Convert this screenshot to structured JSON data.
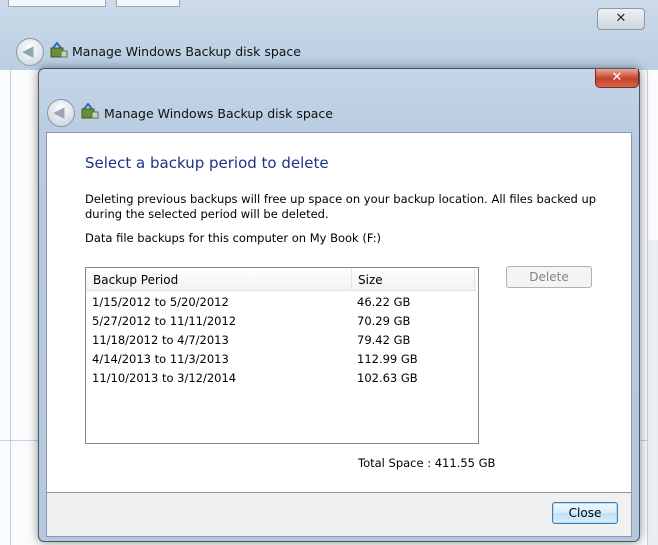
{
  "background": {
    "window_title": "Manage Windows Backup disk space",
    "close_glyph": "✕"
  },
  "dialog": {
    "window_title": "Manage Windows Backup disk space",
    "close_glyph": "✕",
    "back_glyph": "◀",
    "heading": "Select a backup period to delete",
    "description": "Deleting previous backups will free up space on your backup location. All files backed up during the selected period will be deleted.",
    "location_text": "Data file backups for this computer on My Book (F:)",
    "table": {
      "columns": [
        "Backup Period",
        "Size"
      ],
      "rows": [
        {
          "period": "1/15/2012 to 5/20/2012",
          "size": "46.22 GB"
        },
        {
          "period": "5/27/2012 to 11/11/2012",
          "size": "70.29 GB"
        },
        {
          "period": "11/18/2012 to 4/7/2013",
          "size": "79.42 GB"
        },
        {
          "period": "4/14/2013 to 11/3/2013",
          "size": "112.99 GB"
        },
        {
          "period": "11/10/2013 to 3/12/2014",
          "size": "102.63 GB"
        }
      ]
    },
    "delete_label": "Delete",
    "total_label": "Total Space : 411.55 GB",
    "close_label": "Close"
  },
  "icons": {
    "back": "back-arrow-icon",
    "backup": "windows-backup-icon",
    "close": "close-icon"
  }
}
